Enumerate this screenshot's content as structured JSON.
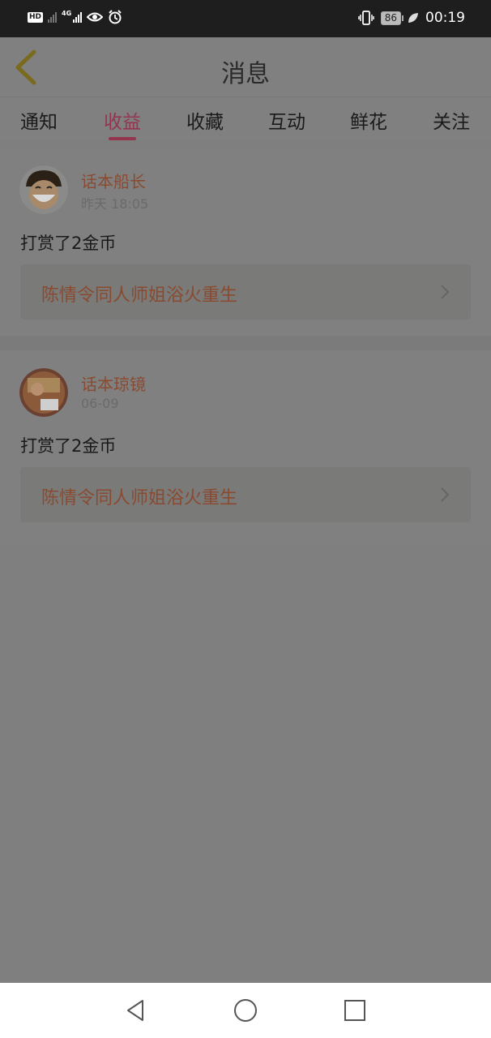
{
  "status_bar": {
    "hd_label": "HD",
    "network_label": "4G",
    "battery_level": "86",
    "time": "00:19",
    "icons": [
      "hd-icon",
      "signal-off-icon",
      "signal-4g-icon",
      "eye-icon",
      "alarm-icon",
      "vibrate-icon",
      "battery-icon",
      "leaf-icon"
    ]
  },
  "header": {
    "title": "消息",
    "back_icon": "chevron-left-icon"
  },
  "tabs": [
    {
      "label": "通知",
      "active": false
    },
    {
      "label": "收益",
      "active": true
    },
    {
      "label": "收藏",
      "active": false
    },
    {
      "label": "互动",
      "active": false
    },
    {
      "label": "鲜花",
      "active": false
    },
    {
      "label": "关注",
      "active": false
    }
  ],
  "messages": [
    {
      "username": "话本船长",
      "time": "昨天 18:05",
      "text": "打赏了2金币",
      "link_title": "陈情令同人师姐浴火重生"
    },
    {
      "username": "话本琼镜",
      "time": "06-09",
      "text": "打赏了2金币",
      "link_title": "陈情令同人师姐浴火重生"
    }
  ],
  "nav_bar": {
    "icons": [
      "back-triangle-icon",
      "home-circle-icon",
      "recents-square-icon"
    ]
  },
  "colors": {
    "accent": "#e0467a",
    "accent_dimmed": "#94344f",
    "username": "#e06a3a",
    "overlay": "rgba(0,0,0,0.5)"
  }
}
